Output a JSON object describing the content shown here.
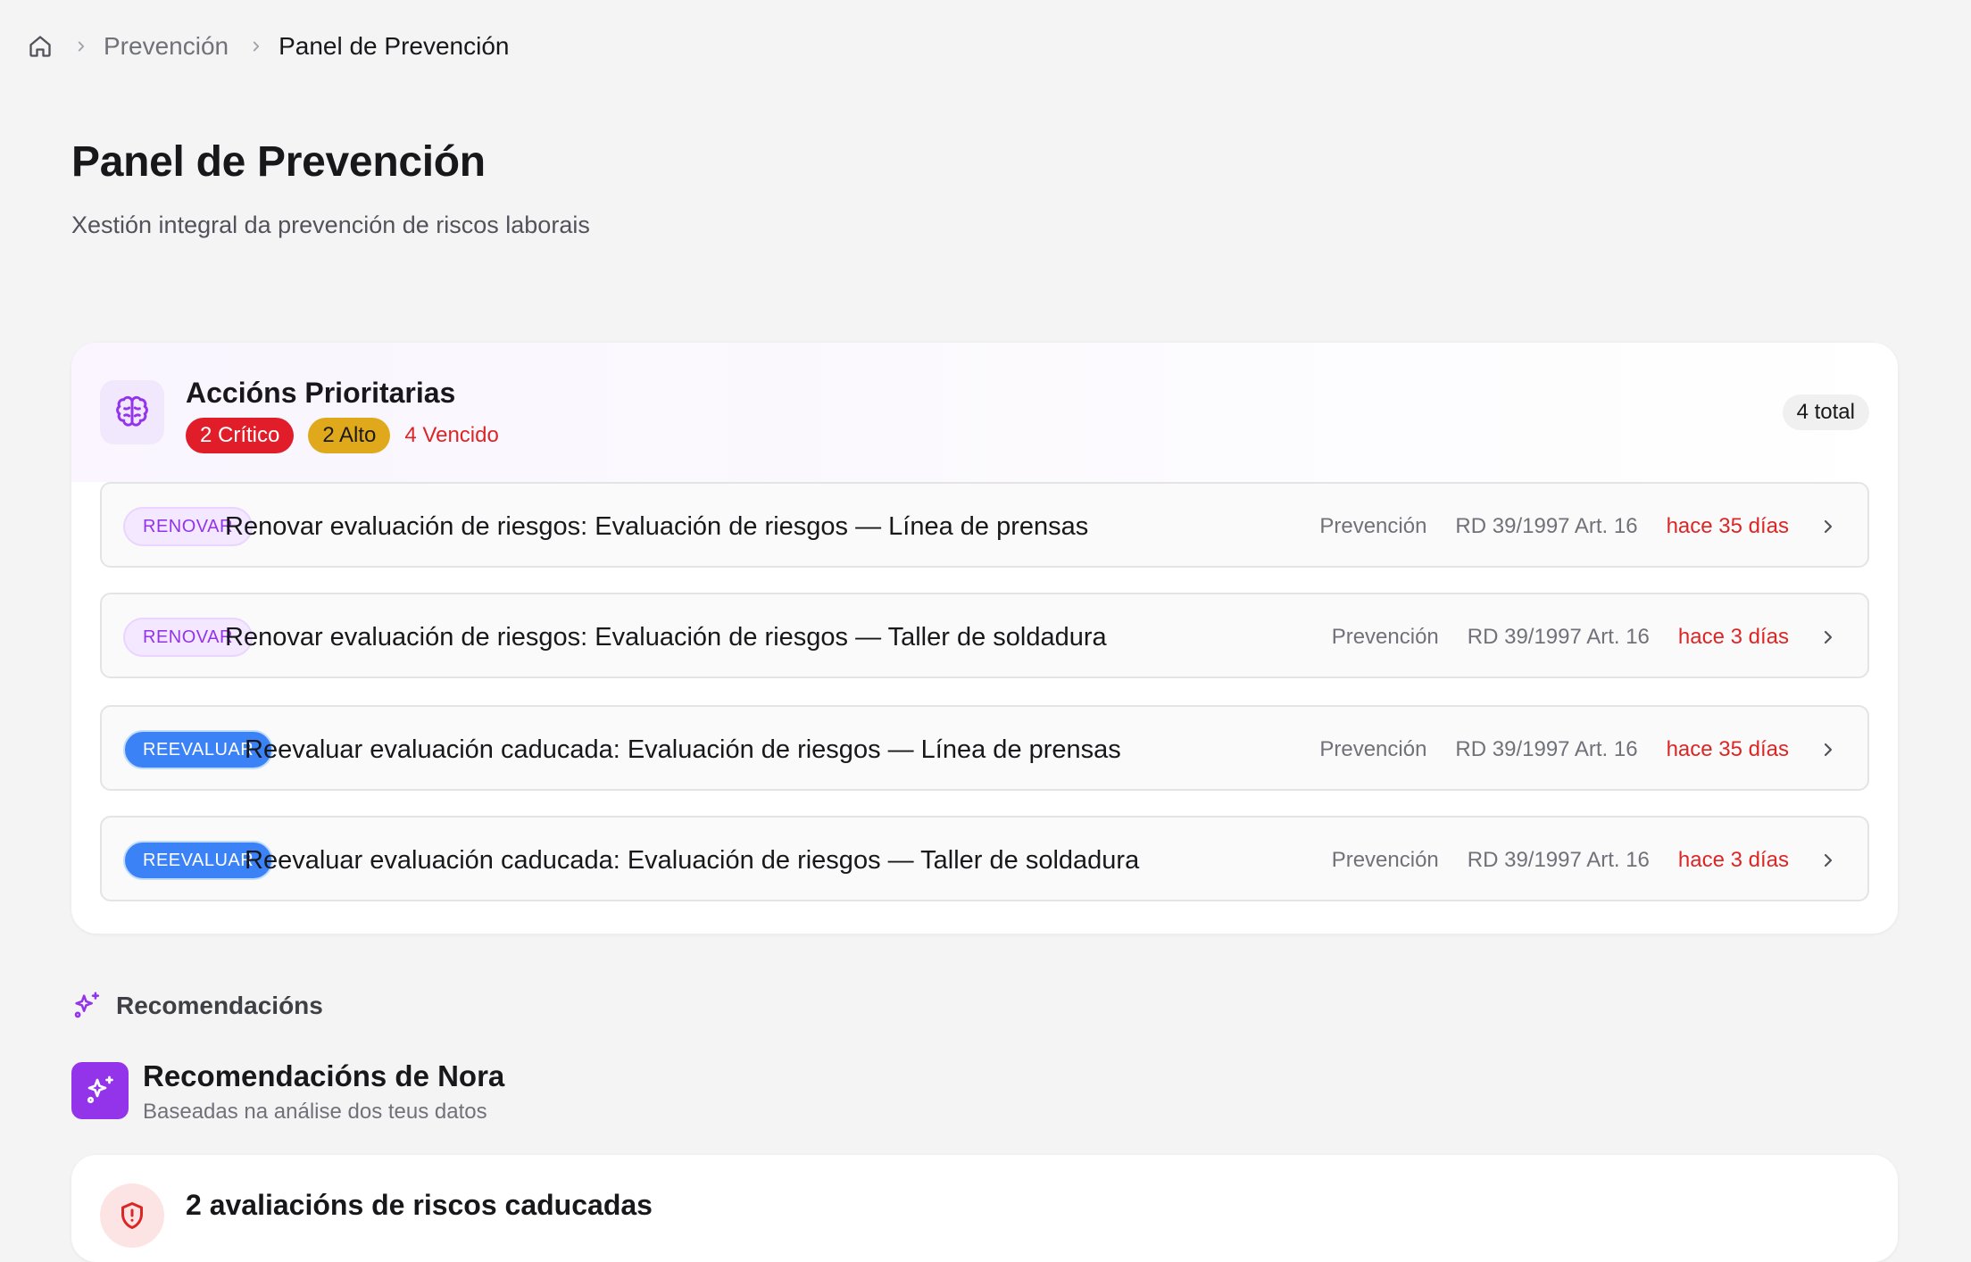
{
  "breadcrumb": {
    "home_icon": "home-icon",
    "items": [
      "Prevención",
      "Panel de Prevención"
    ]
  },
  "page": {
    "title": "Panel de Prevención",
    "subtitle": "Xestión integral da prevención de riscos laborais"
  },
  "priority": {
    "icon": "brain-icon",
    "title": "Accións Prioritarias",
    "critical": "2 Crítico",
    "high": "2 Alto",
    "overdue": "4 Vencido",
    "total": "4 total",
    "rows": [
      {
        "tag": "RENOVAR",
        "title": "Renovar evaluación de riesgos: Evaluación de riesgos — Línea de prensas",
        "category": "Prevención",
        "law": "RD 39/1997 Art. 16",
        "ago": "hace 35 días"
      },
      {
        "tag": "RENOVAR",
        "title": "Renovar evaluación de riesgos: Evaluación de riesgos — Taller de soldadura",
        "category": "Prevención",
        "law": "RD 39/1997 Art. 16",
        "ago": "hace 3 días"
      },
      {
        "tag": "REEVALUAR",
        "title": "Reevaluar evaluación caducada: Evaluación de riesgos — Línea de prensas",
        "category": "Prevención",
        "law": "RD 39/1997 Art. 16",
        "ago": "hace 35 días"
      },
      {
        "tag": "REEVALUAR",
        "title": "Reevaluar evaluación caducada: Evaluación de riesgos — Taller de soldadura",
        "category": "Prevención",
        "law": "RD 39/1997 Art. 16",
        "ago": "hace 3 días"
      }
    ]
  },
  "recommendations": {
    "section_label": "Recomendacións",
    "nora_title": "Recomendacións de Nora",
    "nora_subtitle": "Baseadas na análise dos teus datos",
    "first_card_title": "2 avaliacións de riscos caducadas"
  },
  "colors": {
    "accent_purple": "#9333ea",
    "critical_red": "#e11d2a",
    "high_amber": "#e0a91c",
    "overdue_red": "#dc2626",
    "reevaluar_blue": "#3b82f6"
  }
}
